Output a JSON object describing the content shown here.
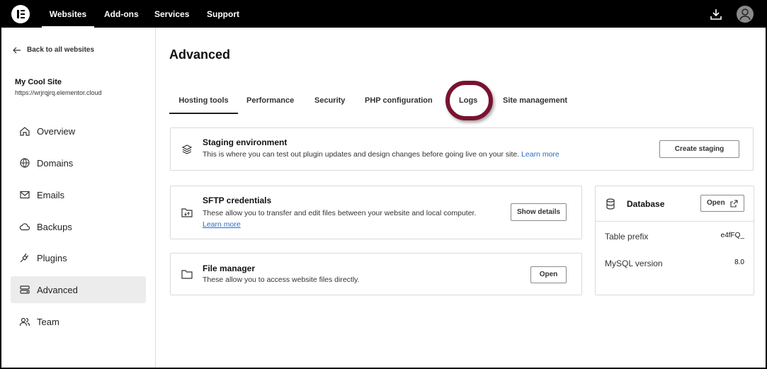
{
  "topbar": {
    "nav": [
      "Websites",
      "Add-ons",
      "Services",
      "Support"
    ],
    "active": "Websites",
    "icons": [
      "elementor-logo-icon",
      "download-icon",
      "user-avatar-icon"
    ]
  },
  "sidebar": {
    "back_label": "Back to all websites",
    "site_name": "My Cool Site",
    "site_url": "https://wrjrqjrq.elementor.cloud",
    "items": [
      {
        "label": "Overview",
        "icon": "home-icon"
      },
      {
        "label": "Domains",
        "icon": "globe-icon"
      },
      {
        "label": "Emails",
        "icon": "mail-icon"
      },
      {
        "label": "Backups",
        "icon": "cloud-icon"
      },
      {
        "label": "Plugins",
        "icon": "plug-icon"
      },
      {
        "label": "Advanced",
        "icon": "server-icon"
      },
      {
        "label": "Team",
        "icon": "team-icon"
      }
    ],
    "active": "Advanced"
  },
  "main": {
    "title": "Advanced",
    "tabs": [
      "Hosting tools",
      "Performance",
      "Security",
      "PHP configuration",
      "Logs",
      "Site management"
    ],
    "active_tab": "Hosting tools",
    "staging": {
      "title": "Staging environment",
      "desc": "This is where you can test out plugin updates and design changes before going live on your site.",
      "link": "Learn more",
      "button": "Create staging"
    },
    "sftp": {
      "title": "SFTP credentials",
      "desc": "These allow you to transfer and edit files between your website and local computer.",
      "link": "Learn more",
      "button": "Show details"
    },
    "file_manager": {
      "title": "File manager",
      "desc": "These allow you to access website files directly.",
      "button": "Open"
    },
    "database": {
      "title": "Database",
      "button": "Open",
      "rows": [
        {
          "label": "Table prefix",
          "value": "e4fFQ_"
        },
        {
          "label": "MySQL version",
          "value": "8.0"
        }
      ]
    }
  }
}
